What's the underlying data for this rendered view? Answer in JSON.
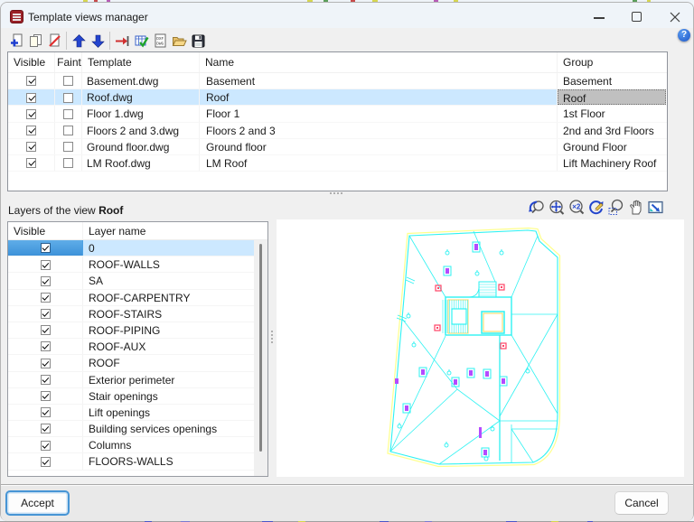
{
  "window": {
    "title": "Template views manager"
  },
  "main_toolbar": {
    "icons": [
      "new-template",
      "copy-template",
      "delete-template",
      "move-up",
      "move-down",
      "import-template",
      "update-template",
      "dxf-dwg-file",
      "open-file",
      "save-file"
    ]
  },
  "help": {
    "label": "?"
  },
  "templates_table": {
    "headers": [
      "Visible",
      "Faint",
      "Template",
      "Name",
      "Group"
    ],
    "selected_index": 1,
    "rows": [
      {
        "visible": true,
        "faint": false,
        "template": "Basement.dwg",
        "name": "Basement",
        "group": "Basement"
      },
      {
        "visible": true,
        "faint": false,
        "template": "Roof.dwg",
        "name": "Roof",
        "group": "Roof"
      },
      {
        "visible": true,
        "faint": false,
        "template": "Floor 1.dwg",
        "name": "Floor 1",
        "group": "1st Floor"
      },
      {
        "visible": true,
        "faint": false,
        "template": "Floors 2 and 3.dwg",
        "name": "Floors 2 and 3",
        "group": "2nd and 3rd Floors"
      },
      {
        "visible": true,
        "faint": false,
        "template": "Ground floor.dwg",
        "name": "Ground floor",
        "group": "Ground Floor"
      },
      {
        "visible": true,
        "faint": false,
        "template": "LM Roof.dwg",
        "name": "LM Roof",
        "group": "Lift Machinery Roof"
      }
    ]
  },
  "layers_section": {
    "label": "Layers of the view",
    "view_name": "Roof"
  },
  "preview_toolbar": {
    "icons": [
      "zoom-previous",
      "zoom-extents",
      "zoom-double",
      "redraw",
      "zoom-window",
      "pan",
      "fit-screen"
    ]
  },
  "layers_table": {
    "headers": [
      "Visible",
      "Layer name"
    ],
    "selected_index": 0,
    "rows": [
      {
        "visible": true,
        "name": "0"
      },
      {
        "visible": true,
        "name": "ROOF-WALLS"
      },
      {
        "visible": true,
        "name": "SA"
      },
      {
        "visible": true,
        "name": "ROOF-CARPENTRY"
      },
      {
        "visible": true,
        "name": "ROOF-STAIRS"
      },
      {
        "visible": true,
        "name": "ROOF-PIPING"
      },
      {
        "visible": true,
        "name": "ROOF-AUX"
      },
      {
        "visible": true,
        "name": "ROOF"
      },
      {
        "visible": true,
        "name": "Exterior perimeter"
      },
      {
        "visible": true,
        "name": "Stair openings"
      },
      {
        "visible": true,
        "name": "Lift openings"
      },
      {
        "visible": true,
        "name": "Building services openings"
      },
      {
        "visible": true,
        "name": "Columns"
      },
      {
        "visible": true,
        "name": "FLOORS-WALLS"
      }
    ]
  },
  "buttons": {
    "accept": "Accept",
    "cancel": "Cancel"
  },
  "colors": {
    "selection": "#cce8ff",
    "focused_cell": "#c0c0c0",
    "focused_checkbox_cell": "#4da1e3",
    "drawing_cyan": "#2ef2f2",
    "drawing_yellow": "#ffff6e",
    "drawing_magenta": "#b44bff",
    "drawing_red": "#ff4466"
  }
}
